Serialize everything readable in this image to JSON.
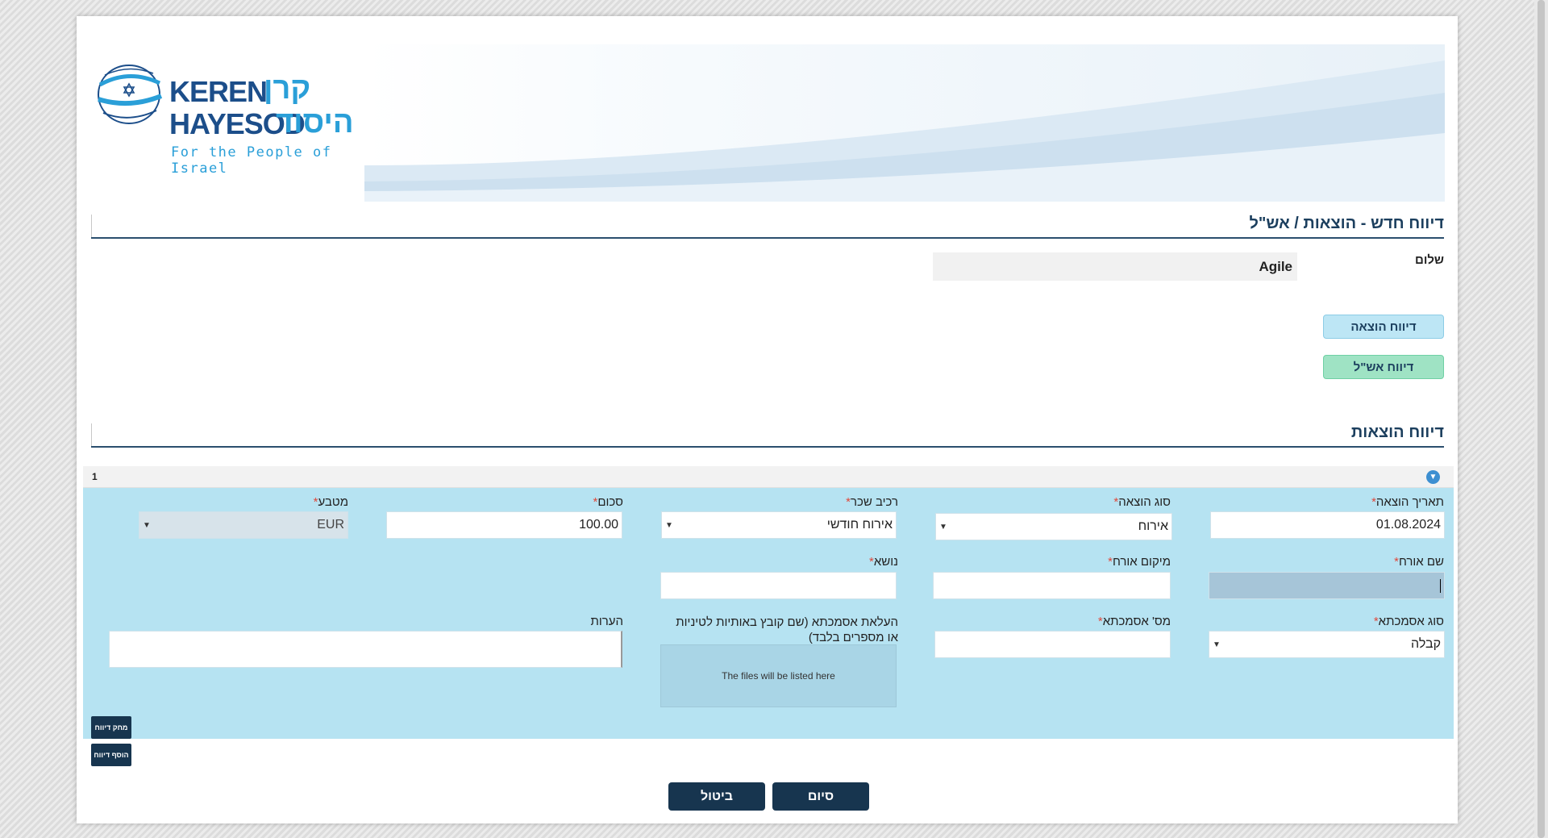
{
  "branding": {
    "logo_en_line1": "KEREN",
    "logo_en_line2": "HAYESOD",
    "logo_he_line1": "קרן",
    "logo_he_line2": "היסוד",
    "tagline": "For the People of Israel",
    "brand_color": "#1c4e8a",
    "accent_color": "#2a9fd8"
  },
  "header": {
    "title": "דיווח חדש - הוצאות / אש\"ל"
  },
  "greeting": {
    "label": "שלום",
    "user": "Agile"
  },
  "report_buttons": {
    "expense": "דיווח הוצאה",
    "per_diem": "דיווח אש\"ל"
  },
  "expenses_section": {
    "title": "דיווח הוצאות",
    "row_number": "1",
    "collapse_icon": "chevron-down-circle-icon"
  },
  "form": {
    "expense_date": {
      "label": "תאריך הוצאה",
      "value": "01.08.2024"
    },
    "expense_type": {
      "label": "סוג הוצאה",
      "value": "אירוח"
    },
    "wage_component": {
      "label": "רכיב שכר",
      "value": "אירוח חודשי"
    },
    "amount": {
      "label": "סכום",
      "value": "100.00"
    },
    "currency": {
      "label": "מטבע",
      "value": "EUR"
    },
    "guest_name": {
      "label": "שם אורח",
      "value": ""
    },
    "guest_location": {
      "label": "מיקום אורח",
      "value": ""
    },
    "subject": {
      "label": "נושא",
      "value": ""
    },
    "voucher_type": {
      "label": "סוג אסמכתא",
      "value": "קבלה"
    },
    "voucher_number": {
      "label": "מס' אסמכתא",
      "value": ""
    },
    "upload": {
      "label": "העלאת אסמכתא (שם קובץ באותיות לטיניות או מספרים בלבד)",
      "dropzone_text": "The files will be listed here"
    },
    "notes": {
      "label": "הערות",
      "value": ""
    },
    "required_marker": "*"
  },
  "row_actions": {
    "delete": "מחק דיווח",
    "add": "הוסף דיווח"
  },
  "footer_buttons": {
    "finish": "סיום",
    "cancel": "ביטול"
  }
}
